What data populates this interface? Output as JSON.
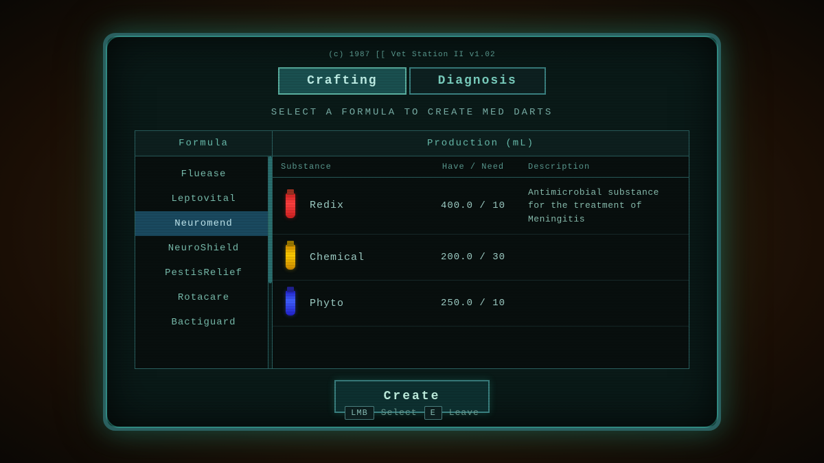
{
  "app": {
    "copyright": "(c) 1987 [[ Vet Station II v1.02",
    "tabs": [
      {
        "id": "crafting",
        "label": "Crafting",
        "active": true
      },
      {
        "id": "diagnosis",
        "label": "Diagnosis",
        "active": false
      }
    ],
    "subtitle": "SELECT A FORMULA TO CREATE MED DARTS"
  },
  "formula_panel": {
    "header": "Formula",
    "items": [
      {
        "id": "fluease",
        "label": "Fluease",
        "selected": false
      },
      {
        "id": "leptovital",
        "label": "Leptovital",
        "selected": false
      },
      {
        "id": "neuromend",
        "label": "Neuromend",
        "selected": true
      },
      {
        "id": "neuroshield",
        "label": "NeuroShield",
        "selected": false
      },
      {
        "id": "pestisrelief",
        "label": "PestisRelief",
        "selected": false
      },
      {
        "id": "rotacare",
        "label": "Rotacare",
        "selected": false
      },
      {
        "id": "bactiguard",
        "label": "Bactiguard",
        "selected": false
      }
    ]
  },
  "production_panel": {
    "header": "Production (mL)",
    "col_substance": "Substance",
    "col_haveneed": "Have / Need",
    "col_description": "Description",
    "rows": [
      {
        "substance": "Redix",
        "vial_color": "red",
        "have": "400.0",
        "need": "10",
        "description": "Antimicrobial substance for the treatment of Meningitis"
      },
      {
        "substance": "Chemical",
        "vial_color": "yellow",
        "have": "200.0",
        "need": "30",
        "description": ""
      },
      {
        "substance": "Phyto",
        "vial_color": "blue",
        "have": "250.0",
        "need": "10",
        "description": ""
      }
    ]
  },
  "buttons": {
    "create": "Create"
  },
  "hints": [
    {
      "key": "LMB",
      "label": "Select"
    },
    {
      "key": "E",
      "label": "Leave"
    }
  ]
}
